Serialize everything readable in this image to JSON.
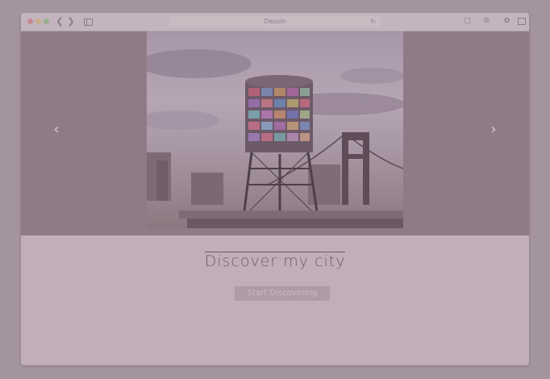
{
  "browser": {
    "address_text": "Dessin",
    "traffic_lights": {
      "close": "#c88a92",
      "minimize": "#c9ae86",
      "maximize": "#98ae8f"
    }
  },
  "carousel": {
    "prev_glyph": "‹",
    "next_glyph": "›",
    "slide_subject": "water-tower-image"
  },
  "hero": {
    "title": "Discover my city",
    "cta_label": "Start Discovering"
  },
  "colors": {
    "page_background": "#a4949f",
    "content_background": "#c0aeb8",
    "carousel_background": "#8f7b88",
    "title_text": "#6e5e68",
    "cta_background": "#ad9ba6"
  }
}
